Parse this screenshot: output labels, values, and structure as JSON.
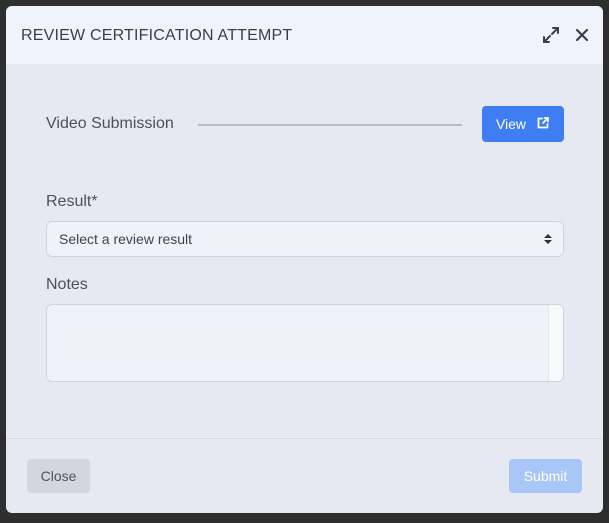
{
  "modal": {
    "title": "REVIEW CERTIFICATION ATTEMPT",
    "expand_icon": "expand-icon",
    "close_icon": "close-icon"
  },
  "video": {
    "label": "Video Submission",
    "view_label": "View",
    "view_icon": "external-link-icon"
  },
  "result": {
    "label": "Result*",
    "selected_text": "Select a review result",
    "arrow_icon": "select-arrows-icon"
  },
  "notes": {
    "label": "Notes",
    "value": ""
  },
  "footer": {
    "close_label": "Close",
    "submit_label": "Submit",
    "submit_disabled": true
  },
  "colors": {
    "primary": "#3f7ef2",
    "primary_disabled": "#a8c6f6",
    "modal_background": "#e6e9f2",
    "header_background": "#eff3fb"
  }
}
